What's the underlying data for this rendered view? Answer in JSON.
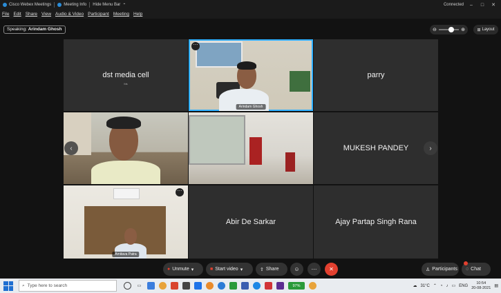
{
  "titlebar": {
    "app_title": "Cisco Webex Meetings",
    "meeting_info": "Meeting Info",
    "hide_menu_bar": "Hide Menu Bar",
    "connection_status": "Connected"
  },
  "menu": [
    "File",
    "Edit",
    "Share",
    "View",
    "Audio & Video",
    "Participant",
    "Meeting",
    "Help"
  ],
  "speaking": {
    "label": "Speaking:",
    "name": "Arindam Ghosh"
  },
  "layout_label": "Layout",
  "tiles": {
    "t1": {
      "name": "dst media cell",
      "sub": "fds"
    },
    "t2": {
      "caption": "Arindam Ghosh"
    },
    "t3": {
      "name": "parry"
    },
    "t6": {
      "name": "MUKESH PANDEY"
    },
    "t7": {
      "caption": "Amitava Patra"
    },
    "t8": {
      "name": "Abir De Sarkar"
    },
    "t9": {
      "name": "Ajay Partap Singh Rana"
    }
  },
  "controls": {
    "unmute": "Unmute",
    "start_video": "Start video",
    "share": "Share",
    "participants": "Participants",
    "chat": "Chat"
  },
  "taskbar": {
    "search_placeholder": "Type here to search",
    "temperature": "31°C",
    "language": "ENG",
    "time": "10:54",
    "date": "20-08-2021",
    "battery_percent": "97%"
  },
  "colors": {
    "active_border": "#2fb0ff",
    "leave_button": "#e2402f",
    "tile_bg": "#2e2e2e"
  }
}
